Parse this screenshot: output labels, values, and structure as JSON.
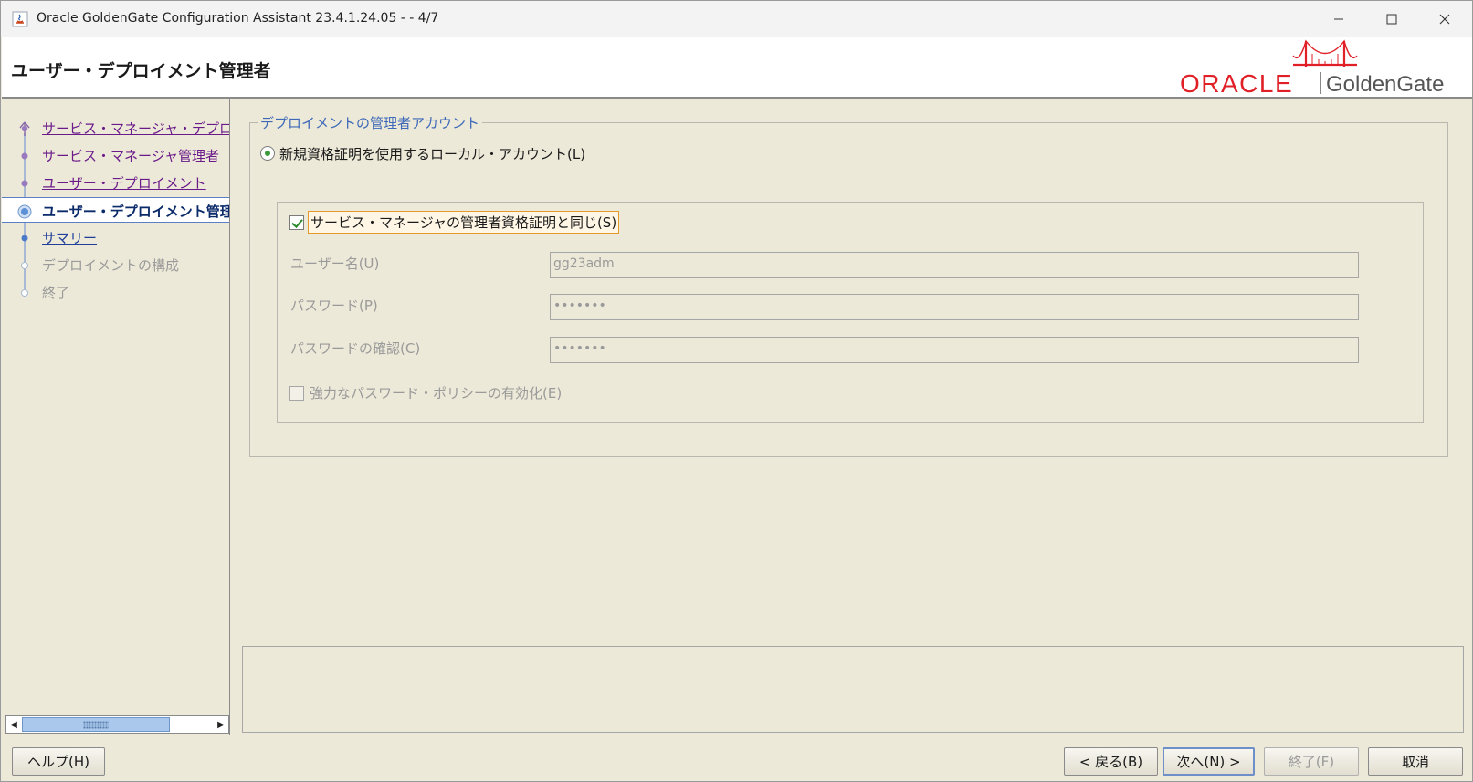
{
  "window": {
    "title": "Oracle GoldenGate Configuration Assistant 23.4.1.24.05 -  - 4/7"
  },
  "header": {
    "page_title": "ユーザー・デプロイメント管理者",
    "logo_oracle": "ORACLE",
    "logo_product": "GoldenGate"
  },
  "nav": {
    "items": [
      {
        "label": "サービス・マネージャ・デプロイメント",
        "state": "visited"
      },
      {
        "label": "サービス・マネージャ管理者",
        "state": "visited"
      },
      {
        "label": "ユーザー・デプロイメント",
        "state": "visited"
      },
      {
        "label": "ユーザー・デプロイメント管理者",
        "state": "current"
      },
      {
        "label": "サマリー",
        "state": "link"
      },
      {
        "label": "デプロイメントの構成",
        "state": "disabled"
      },
      {
        "label": "終了",
        "state": "disabled"
      }
    ]
  },
  "form": {
    "group_title": "デプロイメントの管理者アカウント",
    "radio_label": "新規資格証明を使用するローカル・アカウント(L)",
    "same_as_sm_label": "サービス・マネージャの管理者資格証明と同じ(S)",
    "username_label": "ユーザー名(U)",
    "username_value": "gg23adm",
    "password_label": "パスワード(P)",
    "password_value": "•••••••",
    "confirm_label": "パスワードの確認(C)",
    "confirm_value": "•••••••",
    "strong_policy_label": "強力なパスワード・ポリシーの有効化(E)"
  },
  "buttons": {
    "help": "ヘルプ(H)",
    "back": "< 戻る(B)",
    "next": "次へ(N) >",
    "finish": "終了(F)",
    "cancel": "取消"
  },
  "colors": {
    "background": "#ece9d8",
    "accent": "#3e68b8",
    "oracle_red": "#e01f26"
  }
}
